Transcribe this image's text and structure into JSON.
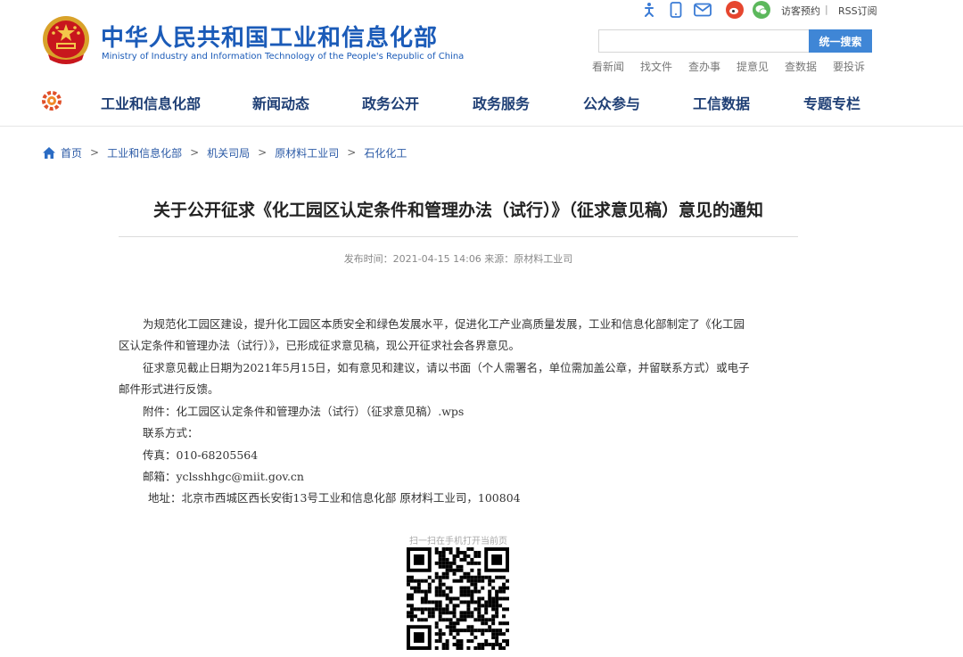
{
  "header": {
    "site_title": "中华人民共和国工业和信息化部",
    "site_title_en": "Ministry of Industry and Information Technology of the People's Republic of China",
    "top_links": {
      "visitor": "访客预约",
      "divider": "|",
      "rss": "RSS订阅"
    },
    "top_icons": [
      "accessibility-icon",
      "mobile-icon",
      "email-icon",
      "weibo-icon",
      "wechat-icon"
    ],
    "search": {
      "placeholder": "",
      "button": "统一搜索"
    },
    "quick_links": [
      "看新闻",
      "找文件",
      "查办事",
      "提意见",
      "查数据",
      "要投诉"
    ]
  },
  "nav": {
    "items": [
      "工业和信息化部",
      "新闻动态",
      "政务公开",
      "政务服务",
      "公众参与",
      "工信数据",
      "专题专栏"
    ]
  },
  "breadcrumb": [
    "首页",
    "工业和信息化部",
    "机关司局",
    "原材料工业司",
    "石化化工"
  ],
  "breadcrumb_sep": ">",
  "article": {
    "title": "关于公开征求《化工园区认定条件和管理办法（试行）》（征求意见稿）意见的通知",
    "meta": "发布时间：2021-04-15 14:06  来源：原材料工业司",
    "paragraphs": [
      "为规范化工园区建设，提升化工园区本质安全和绿色发展水平，促进化工产业高质量发展，工业和信息化部制定了《化工园",
      "区认定条件和管理办法（试行）》，已形成征求意见稿，现公开征求社会各界意见。",
      "征求意见截止日期为2021年5月15日，如有意见和建议，请以书面（个人需署名，单位需加盖公章，并留联系方式）或电子",
      "邮件形式进行反馈。",
      "附件：化工园区认定条件和管理办法（试行）（征求意见稿）.wps",
      "联系方式：",
      "传真：010-68205564",
      "邮箱：yclsshhgc@miit.gov.cn",
      "地址：北京市西城区西长安街13号工业和信息化部    原材料工业司，100804"
    ]
  },
  "qr": {
    "caption": "扫一扫在手机打开当前页"
  },
  "colors": {
    "brand_blue": "#1b5bb8",
    "nav_text": "#1f3f75",
    "search_btn": "#3f86d6",
    "link": "#2b5aa6"
  }
}
